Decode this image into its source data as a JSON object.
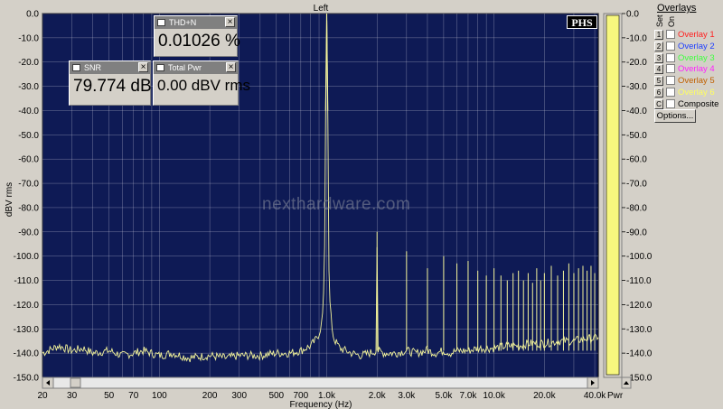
{
  "chart_data": {
    "type": "line",
    "title": "Left",
    "xlabel": "Frequency (Hz)",
    "ylabel": "dBV rms",
    "x_scale": "log",
    "xlim": [
      20,
      42000
    ],
    "ylim": [
      -150,
      0
    ],
    "grid": true,
    "x_ticks": [
      20,
      30,
      50,
      70,
      100,
      200,
      300,
      500,
      700,
      1000,
      2000,
      3000,
      5000,
      7000,
      10000,
      20000,
      40000
    ],
    "x_tick_labels": [
      "20",
      "30",
      "50",
      "70",
      "100",
      "200",
      "300",
      "500",
      "700",
      "1.0k",
      "2.0k",
      "3.0k",
      "5.0k",
      "7.0k",
      "10.0k",
      "20.0k",
      "40.0k"
    ],
    "y_ticks": [
      0,
      -10,
      -20,
      -30,
      -40,
      -50,
      -60,
      -70,
      -80,
      -90,
      -100,
      -110,
      -120,
      -130,
      -140,
      -150
    ],
    "y_tick_labels": [
      "0.0",
      "-10.0",
      "-20.0",
      "-30.0",
      "-40.0",
      "-50.0",
      "-60.0",
      "-70.0",
      "-80.0",
      "-90.0",
      "-100.0",
      "-110.0",
      "-120.0",
      "-130.0",
      "-140.0",
      "-150.0"
    ],
    "series": [
      {
        "x": [
          20,
          25,
          30,
          35,
          40,
          50,
          60,
          70,
          80,
          100,
          120,
          150,
          200,
          250,
          300,
          400,
          500,
          600,
          700,
          800,
          850,
          900,
          930,
          950,
          970,
          985,
          1000,
          1015,
          1030,
          1050,
          1080,
          1100,
          1200,
          1400,
          1600,
          1800,
          1990,
          2000,
          2010,
          2200,
          2600,
          2990,
          3000,
          3010,
          3400,
          3990,
          4000,
          4010,
          4500,
          4990,
          5000,
          5010,
          5500,
          5990,
          6000,
          6010,
          7000,
          8000,
          9000,
          10000,
          12000,
          14000,
          16000,
          20000,
          25000,
          30000,
          35000,
          40000,
          42000
        ],
        "y": [
          -140,
          -137,
          -139,
          -138,
          -140,
          -139,
          -141,
          -140,
          -139,
          -141,
          -140,
          -142,
          -141,
          -142,
          -141,
          -141,
          -140,
          -140,
          -139,
          -137,
          -135,
          -132,
          -128,
          -122,
          -105,
          -40,
          0,
          -40,
          -105,
          -122,
          -130,
          -134,
          -138,
          -140,
          -141,
          -140,
          -139,
          -90,
          -139,
          -140,
          -140,
          -139,
          -98,
          -139,
          -140,
          -139,
          -105,
          -139,
          -140,
          -139,
          -100,
          -139,
          -140,
          -139,
          -103,
          -139,
          -139,
          -138,
          -138,
          -138,
          -137,
          -137,
          -136,
          -136,
          -135,
          -135,
          -134,
          -134,
          -133
        ],
        "harmonic_peaks": [
          {
            "f": 2000,
            "db": -90
          },
          {
            "f": 3000,
            "db": -98
          },
          {
            "f": 4000,
            "db": -105
          },
          {
            "f": 5000,
            "db": -100
          },
          {
            "f": 6000,
            "db": -103
          },
          {
            "f": 7000,
            "db": -102
          },
          {
            "f": 8000,
            "db": -106
          },
          {
            "f": 9000,
            "db": -108
          },
          {
            "f": 10000,
            "db": -105
          },
          {
            "f": 11000,
            "db": -108
          },
          {
            "f": 12000,
            "db": -110
          },
          {
            "f": 13000,
            "db": -107
          },
          {
            "f": 14000,
            "db": -106
          },
          {
            "f": 15000,
            "db": -110
          },
          {
            "f": 16000,
            "db": -107
          },
          {
            "f": 17000,
            "db": -111
          },
          {
            "f": 18000,
            "db": -105
          },
          {
            "f": 19000,
            "db": -110
          },
          {
            "f": 20000,
            "db": -107
          },
          {
            "f": 22000,
            "db": -104
          },
          {
            "f": 24000,
            "db": -108
          },
          {
            "f": 26000,
            "db": -106
          },
          {
            "f": 28000,
            "db": -103
          },
          {
            "f": 30000,
            "db": -107
          },
          {
            "f": 32000,
            "db": -105
          },
          {
            "f": 34000,
            "db": -104
          },
          {
            "f": 36000,
            "db": -106
          },
          {
            "f": 38000,
            "db": -104
          },
          {
            "f": 40000,
            "db": -107
          }
        ]
      }
    ],
    "colors": {
      "plot_bg": "#0e1a55",
      "trace": "#f4f49a",
      "grid": "#c8c8d8",
      "power_bar": "#f7f77e"
    }
  },
  "meters": {
    "thd": {
      "title": "THD+N",
      "value": "0.01026 %"
    },
    "snr": {
      "title": "SNR",
      "value": "79.774 dB"
    },
    "pwr": {
      "title": "Total Pwr",
      "value": "0.00 dBV rms"
    }
  },
  "logo": "PHS",
  "watermark": "nexthardware.com",
  "power_bar": {
    "label": "Pwr",
    "level_fraction": 1.0,
    "tick_labels": [
      "0.0",
      "-10.0",
      "-20.0",
      "-30.0",
      "-40.0",
      "-50.0",
      "-60.0",
      "-70.0",
      "-80.0",
      "-90.0",
      "-100.0",
      "-110.0",
      "-120.0",
      "-130.0",
      "-140.0",
      "-150.0"
    ]
  },
  "overlays": {
    "title": "Overlays",
    "col_set": "Set",
    "col_on": "On",
    "items": [
      {
        "num": "1",
        "label": "Overlay 1",
        "color": "#ff2020"
      },
      {
        "num": "2",
        "label": "Overlay 2",
        "color": "#2040ff"
      },
      {
        "num": "3",
        "label": "Overlay 3",
        "color": "#40ff40"
      },
      {
        "num": "4",
        "label": "Overlay 4",
        "color": "#ff20ff"
      },
      {
        "num": "5",
        "label": "Overlay 5",
        "color": "#c06000"
      },
      {
        "num": "6",
        "label": "Overlay 6",
        "color": "#ffff60"
      },
      {
        "num": "C",
        "label": "Composite",
        "color": "#000000"
      }
    ],
    "options_label": "Options..."
  }
}
